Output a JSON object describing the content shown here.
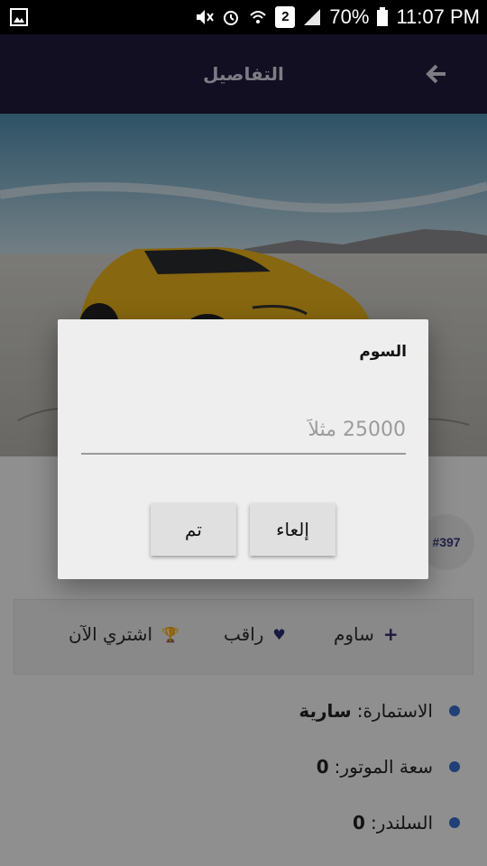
{
  "status_bar": {
    "battery_percent": "70%",
    "time": "11:07 PM",
    "sim_slot": "2",
    "icons": [
      "image-notification-icon",
      "mute-icon",
      "alarm-icon",
      "wifi-icon",
      "signal-icon",
      "battery-icon"
    ]
  },
  "app_bar": {
    "title": "التفاصيل",
    "back_icon": "arrow-back-icon"
  },
  "badge": "#397",
  "actions": [
    {
      "label": "ساوم",
      "icon": "plus-icon"
    },
    {
      "label": "راقب",
      "icon": "heart-icon"
    },
    {
      "label": "اشتري الآن",
      "icon": "trophy-icon"
    }
  ],
  "specs": [
    {
      "label": "الاستمارة:",
      "value": "سارية"
    },
    {
      "label": "سعة الموتور:",
      "value": "0"
    },
    {
      "label": "السلندر:",
      "value": "0"
    }
  ],
  "dialog": {
    "title": "السوم",
    "input_placeholder": "25000 مثلاً",
    "input_value": "",
    "cancel_label": "إلعاء",
    "done_label": "تم"
  },
  "colors": {
    "app_bar": "#1e1b3a",
    "accent": "#2c2a6e",
    "spec_dot": "#3a6fcc",
    "car": "#e8b21a"
  }
}
